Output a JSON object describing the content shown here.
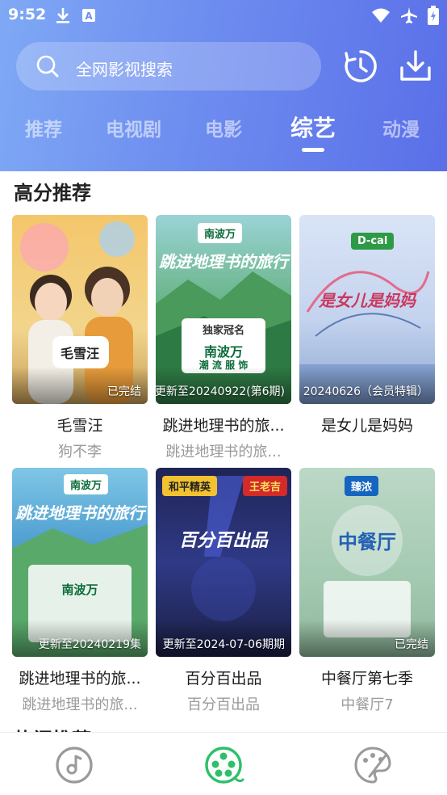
{
  "status_bar": {
    "time": "9:52",
    "left_icons": [
      "download-icon",
      "text-a-icon"
    ],
    "right_icons": [
      "wifi-icon",
      "airplane-icon",
      "battery-icon"
    ]
  },
  "search": {
    "placeholder": "全网影视搜索"
  },
  "header_actions": [
    "history-icon",
    "download-icon"
  ],
  "tabs": [
    {
      "label": "推荐",
      "active": false
    },
    {
      "label": "电视剧",
      "active": false
    },
    {
      "label": "电影",
      "active": false
    },
    {
      "label": "综艺",
      "active": true
    },
    {
      "label": "动漫",
      "active": false
    }
  ],
  "sections": {
    "high_score": "高分推荐",
    "hot": "热门推荐"
  },
  "cards": [
    {
      "title": "毛雪汪",
      "subtitle": "狗不李",
      "badge": "已完结",
      "poster_art": "毛雪汪",
      "poster_color": "#f6d37b"
    },
    {
      "title": "跳进地理书的旅...",
      "subtitle": "跳进地理书的旅...",
      "badge": "更新至20240922(第6期)",
      "poster_art": "跳进地理书的旅行",
      "brand": "南波万",
      "brand_line": "独家冠名",
      "brand_slogan": "潮 流 服 饰",
      "poster_color": "#4f9b6a"
    },
    {
      "title": "是女儿是妈妈",
      "subtitle": "",
      "badge": "20240626（会员特辑）",
      "poster_art": "是女儿是妈妈",
      "brand": "D-cal",
      "poster_color": "#c9d7ef"
    },
    {
      "title": "跳进地理书的旅...",
      "subtitle": "跳进地理书的旅...",
      "badge": "更新至20240219集",
      "poster_art": "跳进地理书的旅行",
      "brand": "南波万",
      "poster_color": "#3d8fbf"
    },
    {
      "title": "百分百出品",
      "subtitle": "百分百出品",
      "badge": "更新至2024-07-06期期",
      "poster_art": "百分百出品",
      "brand": "和平精英",
      "brand2": "王老吉",
      "poster_color": "#2d3470"
    },
    {
      "title": "中餐厅第七季",
      "subtitle": "中餐厅7",
      "badge": "已完结",
      "poster_art": "中餐厅",
      "brand": "臻浓",
      "poster_color": "#a9cbb8"
    }
  ],
  "bottom_nav": [
    {
      "icon": "music-disc-icon",
      "active": false
    },
    {
      "icon": "film-reel-icon",
      "active": true
    },
    {
      "icon": "palette-icon",
      "active": false
    }
  ],
  "colors": {
    "header_start": "#7fa9f5",
    "header_end": "#5a6fe8",
    "active_nav": "#2fbf6a",
    "inactive_nav": "#9a9a9a"
  }
}
